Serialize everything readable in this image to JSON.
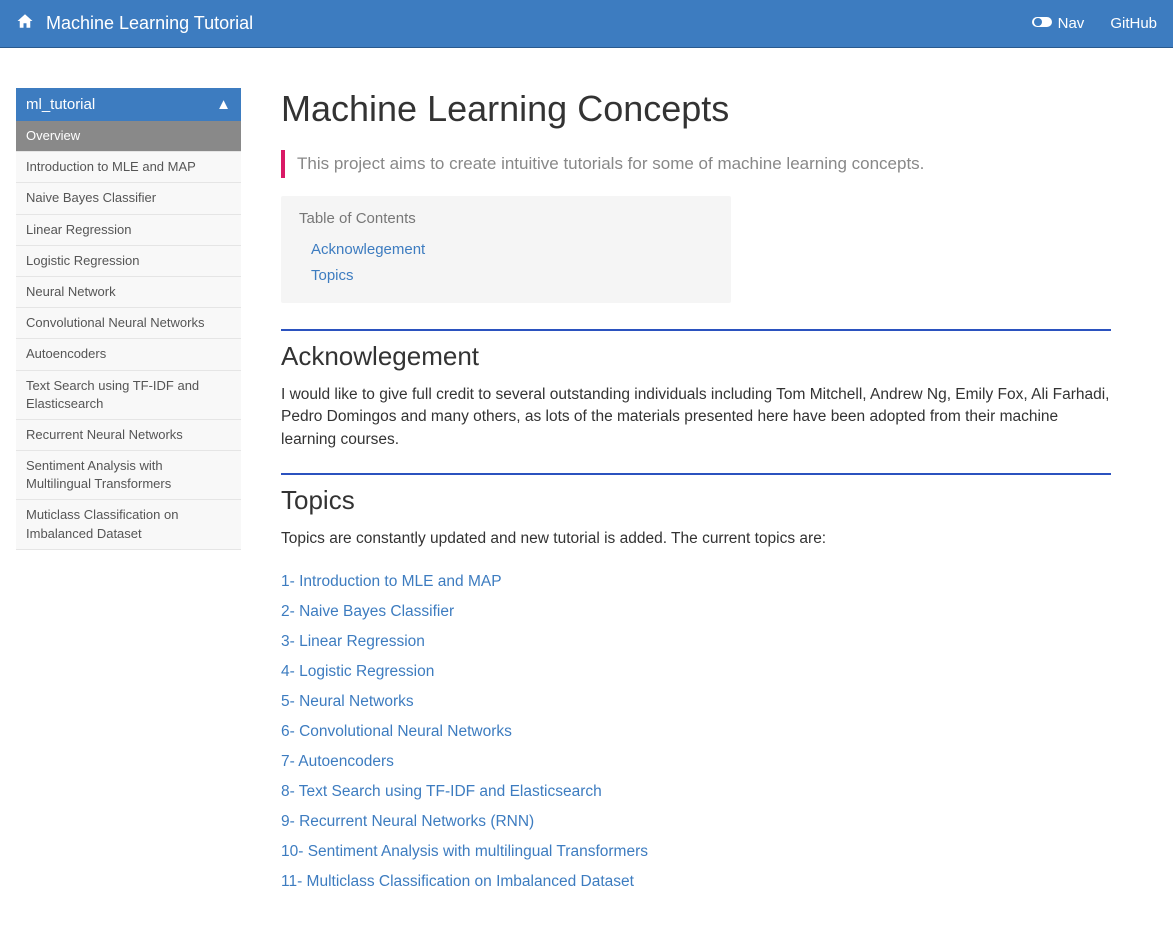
{
  "navbar": {
    "brand": "Machine Learning Tutorial",
    "nav_label": "Nav",
    "github_label": "GitHub"
  },
  "sidebar": {
    "header": "ml_tutorial",
    "triangle": "▲",
    "items": [
      {
        "label": "Overview",
        "active": true
      },
      {
        "label": "Introduction to MLE and MAP",
        "active": false
      },
      {
        "label": "Naive Bayes Classifier",
        "active": false
      },
      {
        "label": "Linear Regression",
        "active": false
      },
      {
        "label": "Logistic Regression",
        "active": false
      },
      {
        "label": "Neural Network",
        "active": false
      },
      {
        "label": "Convolutional Neural Networks",
        "active": false
      },
      {
        "label": "Autoencoders",
        "active": false
      },
      {
        "label": "Text Search using TF-IDF and Elasticsearch",
        "active": false
      },
      {
        "label": "Recurrent Neural Networks",
        "active": false
      },
      {
        "label": "Sentiment Analysis with Multilingual Transformers",
        "active": false
      },
      {
        "label": "Muticlass Classification on Imbalanced Dataset",
        "active": false
      }
    ]
  },
  "page": {
    "title": "Machine Learning Concepts",
    "intro": "This project aims to create intuitive tutorials for some of machine learning concepts.",
    "toc_title": "Table of Contents",
    "toc": [
      {
        "label": "Acknowlegement"
      },
      {
        "label": "Topics"
      }
    ],
    "ack_heading": "Acknowlegement",
    "ack_body": "I would like to give full credit to several outstanding individuals including Tom Mitchell, Andrew Ng, Emily Fox, Ali Farhadi, Pedro Domingos and many others, as lots of the materials presented here have been adopted from their machine learning courses.",
    "topics_heading": "Topics",
    "topics_intro": "Topics are constantly updated and new tutorial is added. The current topics are:",
    "topics": [
      {
        "label": "1- Introduction to MLE and MAP"
      },
      {
        "label": "2- Naive Bayes Classifier"
      },
      {
        "label": "3- Linear Regression"
      },
      {
        "label": "4- Logistic Regression"
      },
      {
        "label": "5- Neural Networks"
      },
      {
        "label": "6- Convolutional Neural Networks"
      },
      {
        "label": "7- Autoencoders"
      },
      {
        "label": "8- Text Search using TF-IDF and Elasticsearch"
      },
      {
        "label": "9- Recurrent Neural Networks (RNN)"
      },
      {
        "label": "10- Sentiment Analysis with multilingual Transformers"
      },
      {
        "label": "11- Multiclass Classification on Imbalanced Dataset"
      }
    ]
  }
}
